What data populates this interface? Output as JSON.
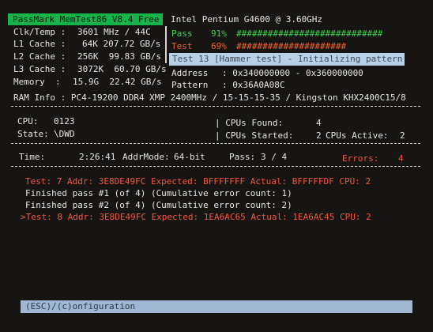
{
  "header": {
    "app_title": "PassMark MemTest86 V8.4 Free",
    "cpu_name": "Intel Pentium G4600 @ 3.60GHz"
  },
  "progress": {
    "pass_label": "Pass",
    "pass_percent": "91%",
    "pass_bar": "############################",
    "test_label": "Test",
    "test_percent": "69%",
    "test_bar": "#####################",
    "current_test": "Test 13 [Hammer test] - Initializing pattern"
  },
  "system": {
    "clk_label": "Clk/Temp :",
    "clk_value": "3601 MHz / 44C",
    "l1_label": "L1 Cache :",
    "l1_value": "64K 207.72 GB/s",
    "l2_label": "L2 Cache :",
    "l2_value": "256K  99.83 GB/s",
    "l3_label": "L3 Cache :",
    "l3_value": "3072K  60.70 GB/s",
    "mem_label": "Memory  :",
    "mem_value": "15.9G  22.42 GB/s",
    "address_label": "Address",
    "address_value": ": 0x340000000 - 0x360000000",
    "pattern_label": "Pattern",
    "pattern_value": ": 0x36A0A08C",
    "ram_info": "RAM Info : PC4-19200 DDR4 XMP 2400MHz / 15-15-15-35 / Kingston KHX2400C15/8"
  },
  "cpu_state": {
    "cpu_label": "CPU:",
    "cpu_value": "0123",
    "state_label": "State:",
    "state_value": "\\DWD",
    "cpus_found_label": "| CPUs Found:",
    "cpus_found_value": "4",
    "cpus_started_label": "| CPUs Started:",
    "cpus_started_value": "2",
    "cpus_active_label": "CPUs Active:",
    "cpus_active_value": "2"
  },
  "status": {
    "time_label": "Time:",
    "time_value": "2:26:41",
    "addrmode_label": "AddrMode:",
    "addrmode_value": "64-bit",
    "pass_label": "Pass:",
    "pass_value": "3 / 4",
    "errors_label": "Errors:",
    "errors_value": "4"
  },
  "log": [
    "Test: 7 Addr: 3E8DE49FC Expected: BFFFFFFF Actual: BFFFFFDF CPU: 2",
    "Finished pass #1 (of 4) (Cumulative error count: 1)",
    "Finished pass #2 (of 4) (Cumulative error count: 2)",
    ">Test: 8 Addr: 3E8DE49FC Expected: 1EA6AC65 Actual: 1EA6AC45 CPU: 2"
  ],
  "footer": {
    "config_hint": "(ESC)/(c)onfiguration"
  },
  "colors": {
    "header_bg": "#15b34a",
    "pass_green": "#3fd24a",
    "test_orange": "#f1632f",
    "error_red": "#f4553a",
    "test_bar_bg": "#b9cfe6",
    "footer_bg": "#9fb7d3"
  }
}
